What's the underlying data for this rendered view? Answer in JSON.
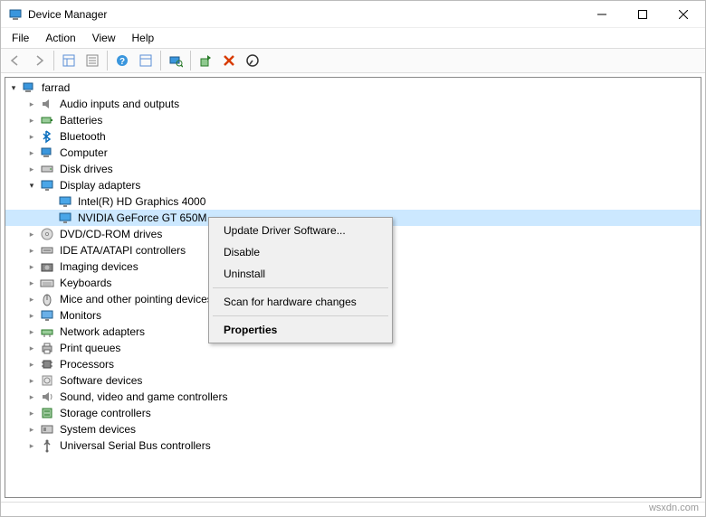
{
  "window": {
    "title": "Device Manager"
  },
  "menus": {
    "file": "File",
    "action": "Action",
    "view": "View",
    "help": "Help"
  },
  "root": {
    "name": "farrad"
  },
  "nodes": [
    {
      "name": "Audio inputs and outputs",
      "icon": "audio"
    },
    {
      "name": "Batteries",
      "icon": "battery"
    },
    {
      "name": "Bluetooth",
      "icon": "bluetooth"
    },
    {
      "name": "Computer",
      "icon": "computer"
    },
    {
      "name": "Disk drives",
      "icon": "disk"
    },
    {
      "name": "Display adapters",
      "icon": "display",
      "expanded": true,
      "children": [
        {
          "name": "Intel(R) HD Graphics 4000",
          "icon": "display"
        },
        {
          "name": "NVIDIA GeForce GT 650M",
          "icon": "display",
          "selected": true
        }
      ]
    },
    {
      "name": "DVD/CD-ROM drives",
      "icon": "dvd"
    },
    {
      "name": "IDE ATA/ATAPI controllers",
      "icon": "ide"
    },
    {
      "name": "Imaging devices",
      "icon": "imaging"
    },
    {
      "name": "Keyboards",
      "icon": "keyboard"
    },
    {
      "name": "Mice and other pointing devices",
      "icon": "mouse"
    },
    {
      "name": "Monitors",
      "icon": "monitor"
    },
    {
      "name": "Network adapters",
      "icon": "network"
    },
    {
      "name": "Print queues",
      "icon": "printer"
    },
    {
      "name": "Processors",
      "icon": "processor"
    },
    {
      "name": "Software devices",
      "icon": "software"
    },
    {
      "name": "Sound, video and game controllers",
      "icon": "sound"
    },
    {
      "name": "Storage controllers",
      "icon": "storage"
    },
    {
      "name": "System devices",
      "icon": "system"
    },
    {
      "name": "Universal Serial Bus controllers",
      "icon": "usb"
    }
  ],
  "context_menu": {
    "update": "Update Driver Software...",
    "disable": "Disable",
    "uninstall": "Uninstall",
    "scan": "Scan for hardware changes",
    "properties": "Properties"
  },
  "watermark": "wsxdn.com"
}
